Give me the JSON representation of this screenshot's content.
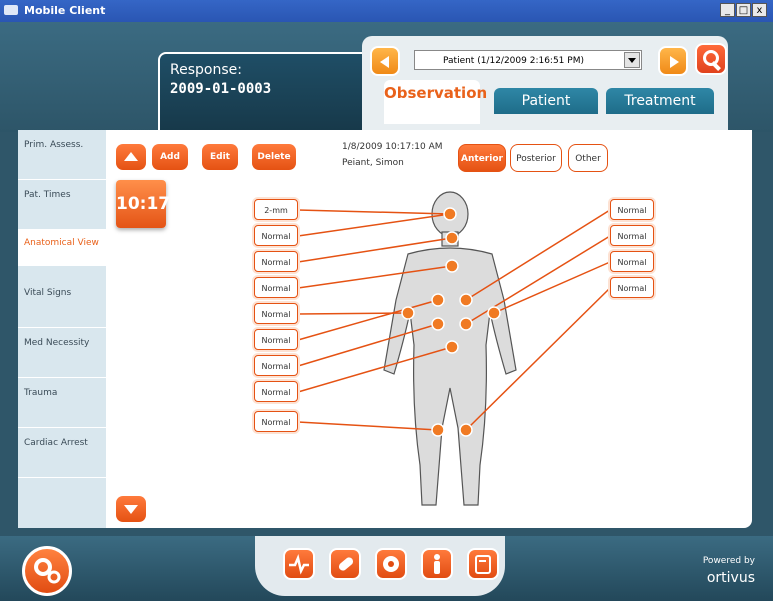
{
  "window": {
    "title": "Mobile Client",
    "controls": [
      "_",
      "□",
      "x"
    ]
  },
  "response": {
    "label": "Response:",
    "number": "2009-01-0003"
  },
  "patient_select": {
    "value": "Patient (1/12/2009 2:16:51 PM)"
  },
  "tabs": [
    {
      "label": "Observation",
      "active": true
    },
    {
      "label": "Patient",
      "active": false
    },
    {
      "label": "Treatment",
      "active": false
    }
  ],
  "sidebar": {
    "items": [
      {
        "label": "Prim. Assess."
      },
      {
        "label": "Pat. Times"
      },
      {
        "label": "Anatomical View",
        "active": true
      },
      {
        "label": "Vital Signs"
      },
      {
        "label": "Med Necessity"
      },
      {
        "label": "Trauma"
      },
      {
        "label": "Cardiac Arrest"
      }
    ]
  },
  "toolbar": {
    "add": "Add",
    "edit": "Edit",
    "delete": "Delete"
  },
  "time_tile": "10:17",
  "record": {
    "datetime": "1/8/2009 10:17:10 AM",
    "patient": "Peiant, Simon"
  },
  "views": [
    {
      "label": "Anterior",
      "active": true
    },
    {
      "label": "Posterior",
      "active": false
    },
    {
      "label": "Other",
      "active": false
    }
  ],
  "left_labels": [
    "2-mm",
    "Normal",
    "Normal",
    "Normal",
    "Normal",
    "Normal",
    "Normal",
    "Normal",
    "Normal"
  ],
  "right_labels": [
    "Normal",
    "Normal",
    "Normal",
    "Normal"
  ],
  "footer": {
    "powered_by": "Powered by",
    "brand": "ortivus"
  },
  "colors": {
    "accent": "#e9621b",
    "navy": "#2f5669",
    "teal_tab": "#1e6c89"
  }
}
